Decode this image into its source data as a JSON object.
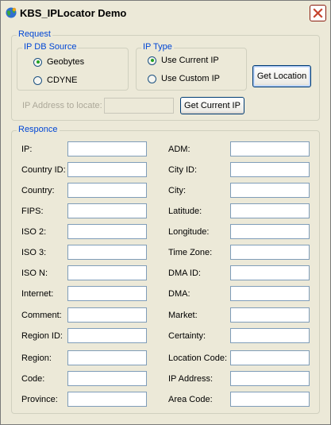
{
  "window": {
    "title": "KBS_IPLocator Demo",
    "icon": "app-globe-icon",
    "close_icon": "close-icon",
    "colors": {
      "background": "#ece9d8",
      "group_title": "#0046d5",
      "close_button": "#c6442e"
    }
  },
  "request": {
    "legend": "Request",
    "db_source": {
      "legend": "IP DB Source",
      "options": [
        {
          "label": "Geobytes",
          "checked": true
        },
        {
          "label": "CDYNE",
          "checked": false
        }
      ]
    },
    "ip_type": {
      "legend": "IP Type",
      "options": [
        {
          "label": "Use Current IP",
          "checked": true
        },
        {
          "label": "Use Custom IP",
          "checked": false
        }
      ]
    },
    "get_location_label": "Get Location",
    "ip_address_label": "IP Address to locate:",
    "ip_address_value": "",
    "get_current_ip_label": "Get Current IP"
  },
  "response": {
    "legend": "Responce",
    "left_fields": [
      {
        "label": "IP:",
        "value": ""
      },
      {
        "label": "Country ID:",
        "value": ""
      },
      {
        "label": "Country:",
        "value": ""
      },
      {
        "label": "FIPS:",
        "value": ""
      },
      {
        "label": "ISO 2:",
        "value": ""
      },
      {
        "label": "ISO 3:",
        "value": ""
      },
      {
        "label": "ISO N:",
        "value": ""
      },
      {
        "label": "Internet:",
        "value": ""
      },
      {
        "label": "Comment:",
        "value": ""
      },
      {
        "label": "Region ID:",
        "value": ""
      },
      {
        "label": "Region:",
        "value": ""
      },
      {
        "label": "Code:",
        "value": ""
      },
      {
        "label": "Province:",
        "value": ""
      }
    ],
    "right_fields": [
      {
        "label": "ADM:",
        "value": ""
      },
      {
        "label": "City ID:",
        "value": ""
      },
      {
        "label": "City:",
        "value": ""
      },
      {
        "label": "Latitude:",
        "value": ""
      },
      {
        "label": "Longitude:",
        "value": ""
      },
      {
        "label": "Time Zone:",
        "value": ""
      },
      {
        "label": "DMA ID:",
        "value": ""
      },
      {
        "label": "DMA:",
        "value": ""
      },
      {
        "label": "Market:",
        "value": ""
      },
      {
        "label": "Certainty:",
        "value": ""
      },
      {
        "label": "Location Code:",
        "value": ""
      },
      {
        "label": "IP Address:",
        "value": ""
      },
      {
        "label": "Area Code:",
        "value": ""
      }
    ]
  }
}
